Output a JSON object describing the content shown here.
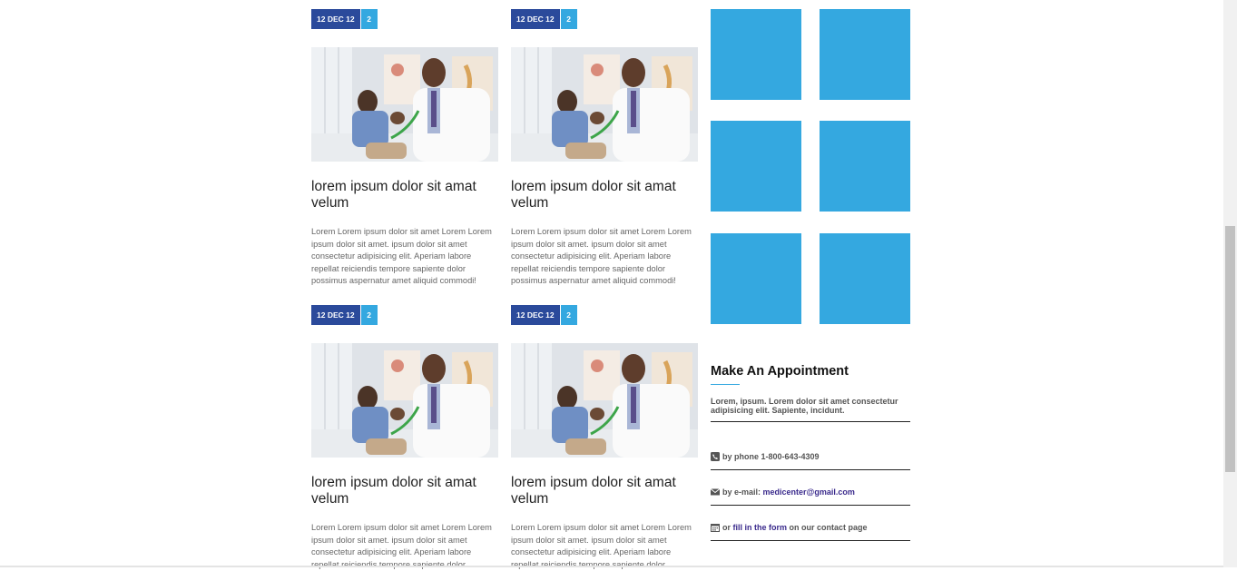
{
  "posts": [
    {
      "date": "12 DEC 12",
      "comments": "2",
      "title": "lorem ipsum dolor sit amat velum",
      "excerpt": "Lorem Lorem ipsum dolor sit amet Lorem Lorem ipsum dolor sit amet. ipsum dolor sit amet consectetur adipisicing elit. Aperiam labore repellat reiciendis tempore sapiente dolor possimus aspernatur amet aliquid commodi!"
    },
    {
      "date": "12 DEC 12",
      "comments": "2",
      "title": "lorem ipsum dolor sit amat velum",
      "excerpt": "Lorem Lorem ipsum dolor sit amet Lorem Lorem ipsum dolor sit amet. ipsum dolor sit amet consectetur adipisicing elit. Aperiam labore repellat reiciendis tempore sapiente dolor possimus aspernatur amet aliquid commodi!"
    },
    {
      "date": "12 DEC 12",
      "comments": "2",
      "title": "lorem ipsum dolor sit amat velum",
      "excerpt": "Lorem Lorem ipsum dolor sit amet Lorem Lorem ipsum dolor sit amet. ipsum dolor sit amet consectetur adipisicing elit. Aperiam labore repellat reiciendis tempore sapiente dolor"
    },
    {
      "date": "12 DEC 12",
      "comments": "2",
      "title": "lorem ipsum dolor sit amat velum",
      "excerpt": "Lorem Lorem ipsum dolor sit amet Lorem Lorem ipsum dolor sit amet. ipsum dolor sit amet consectetur adipisicing elit. Aperiam labore repellat reiciendis tempore sapiente dolor"
    }
  ],
  "gallery": {
    "tile_color": "#34a8e0"
  },
  "appointment": {
    "title": "Make An Appointment",
    "text": "Lorem, ipsum. Lorem dolor sit amet consectetur adipisicing elit. Sapiente, incidunt.",
    "phone": {
      "icon": "phone-icon",
      "label": "by phone 1-800-643-4309"
    },
    "email": {
      "icon": "envelope-icon",
      "prefix": "by e-mail:",
      "address": "medicenter@gmail.com"
    },
    "form": {
      "icon": "calendar-icon",
      "prefix": "or",
      "link": "fill in the form",
      "suffix": "on our contact page"
    }
  },
  "colors": {
    "date_badge": "#2b4a9b",
    "count_badge": "#34a8e0",
    "link": "#3a2a8c"
  }
}
